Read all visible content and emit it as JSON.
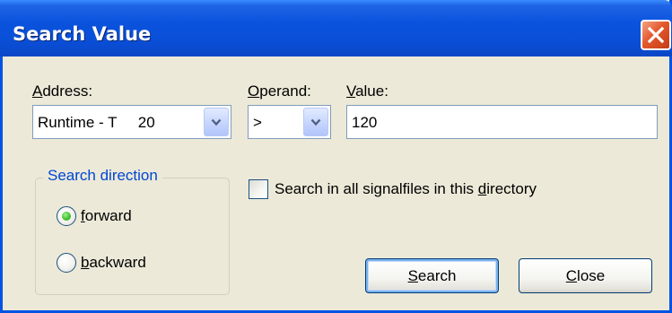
{
  "window": {
    "title": "Search Value",
    "close_icon": "close-icon"
  },
  "address": {
    "label_hotkey": "A",
    "label_rest": "ddress:",
    "selected_value": "Runtime - T     20"
  },
  "operand": {
    "label_hotkey": "O",
    "label_rest": "perand:",
    "selected_value": ">"
  },
  "value": {
    "label_hotkey": "V",
    "label_rest": "alue:",
    "current_value": "120"
  },
  "search_direction": {
    "title": "Search direction",
    "options": [
      {
        "hotkey": "f",
        "label_rest": "orward",
        "selected": true
      },
      {
        "hotkey": "b",
        "label_rest": "ackward",
        "selected": false
      }
    ]
  },
  "all_signalfiles": {
    "label_prefix": "Search in all signalfiles in this ",
    "label_hotkey": "d",
    "label_suffix": "irectory",
    "checked": false
  },
  "buttons": {
    "search": {
      "hotkey": "S",
      "label_rest": "earch"
    },
    "close": {
      "hotkey": "C",
      "label_rest": "lose"
    }
  },
  "colors": {
    "titlebar": "#0a53dd",
    "window_bg": "#ece9d8",
    "group_title": "#0046d5",
    "close_button": "#e3582d"
  }
}
